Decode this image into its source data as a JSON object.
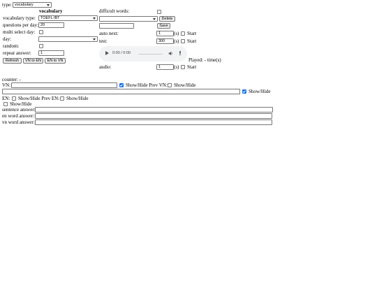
{
  "type_selector": {
    "label": "type:",
    "value": "vocabulary"
  },
  "section_title": "vocabulary",
  "left": {
    "vocab_type_label": "vocabulary type:",
    "vocab_type_value": "TOEFL IBT",
    "questions_per_day_label": "questions per day:",
    "questions_per_day_value": "20",
    "multi_select_day_label": "multi select day:",
    "day_label": "day:",
    "day_value": "",
    "random_label": "random:",
    "repeat_answer_label": "repeat answer:",
    "repeat_answer_value": "1",
    "refresh_label": "Refresh",
    "vn_to_en_label": "VN to EN",
    "en_to_vn_label": "EN to VN"
  },
  "right": {
    "difficult_words_label": "difficult words:",
    "difficult_select_value": "",
    "delete_label": "Delete",
    "new_word_value": "",
    "save_label": "Save",
    "auto_next_label": "auto next:",
    "auto_next_value": "1",
    "test_label": "test:",
    "test_value": "300",
    "seconds_unit": "(s)",
    "start_label": "Start",
    "player_time": "0:00 / 0:00",
    "played_text": "Played: - time(s)",
    "audio_label": "audio:",
    "audio_value": "1"
  },
  "bottom": {
    "counter_text": "counter: -",
    "vn_label": "VN:",
    "vn_value": "",
    "show_hide_label": "Show/Hide",
    "show_hide_prev_vn_label": "Show/Hide Prev VN:",
    "long_input_value": "",
    "en_label": "EN:",
    "show_hide_prev_en_label": "Show/Hide Prev EN:",
    "sentence_answer_label": "sentence answer:",
    "en_word_answer_label": "en word answer:",
    "vn_word_answer_label": "vn word answer:"
  }
}
